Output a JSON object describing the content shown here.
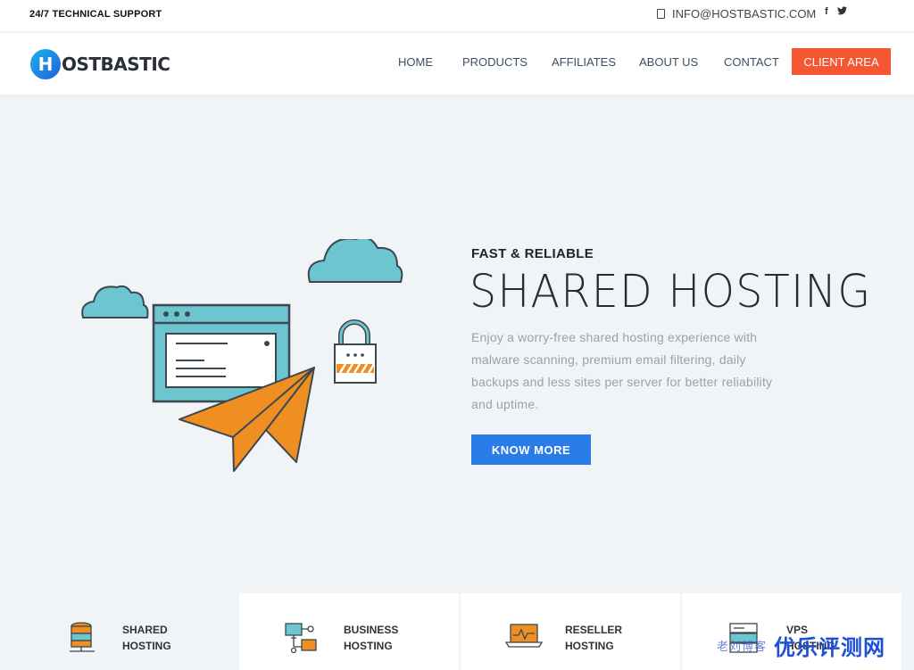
{
  "topbar": {
    "support_text": "24/7 TECHNICAL SUPPORT",
    "email": "INFO@HOSTBASTIC.COM",
    "social": [
      "f",
      "t"
    ]
  },
  "navbar": {
    "logo_letter": "H",
    "logo_text": "OSTBASTIC",
    "items": [
      "HOME",
      "PRODUCTS",
      "AFFILIATES",
      "ABOUT US",
      "CONTACT"
    ],
    "cta": "CLIENT AREA"
  },
  "hero": {
    "eyebrow": "FAST & RELIABLE",
    "headline": "SHARED HOSTING",
    "description": "Enjoy a worry-free shared hosting experience with malware scanning, premium email filtering, daily backups and less sites per server for better reliability and uptime.",
    "button": "KNOW MORE"
  },
  "products": [
    {
      "line1": "SHARED",
      "line2": "HOSTING",
      "icon": "database-icon"
    },
    {
      "line1": "BUSINESS",
      "line2": "HOSTING",
      "icon": "network-icon"
    },
    {
      "line1": "RESELLER",
      "line2": "HOSTING",
      "icon": "laptop-icon"
    },
    {
      "line1": "VPS",
      "line2": "HOSTING",
      "icon": "server-icon"
    }
  ],
  "watermark": {
    "small": "老刘博客",
    "big": "优乐评测网"
  },
  "colors": {
    "accent_orange": "#f55733",
    "accent_blue": "#2a7de8",
    "illustration_teal": "#6cc5cf",
    "illustration_orange": "#ef8f22"
  }
}
